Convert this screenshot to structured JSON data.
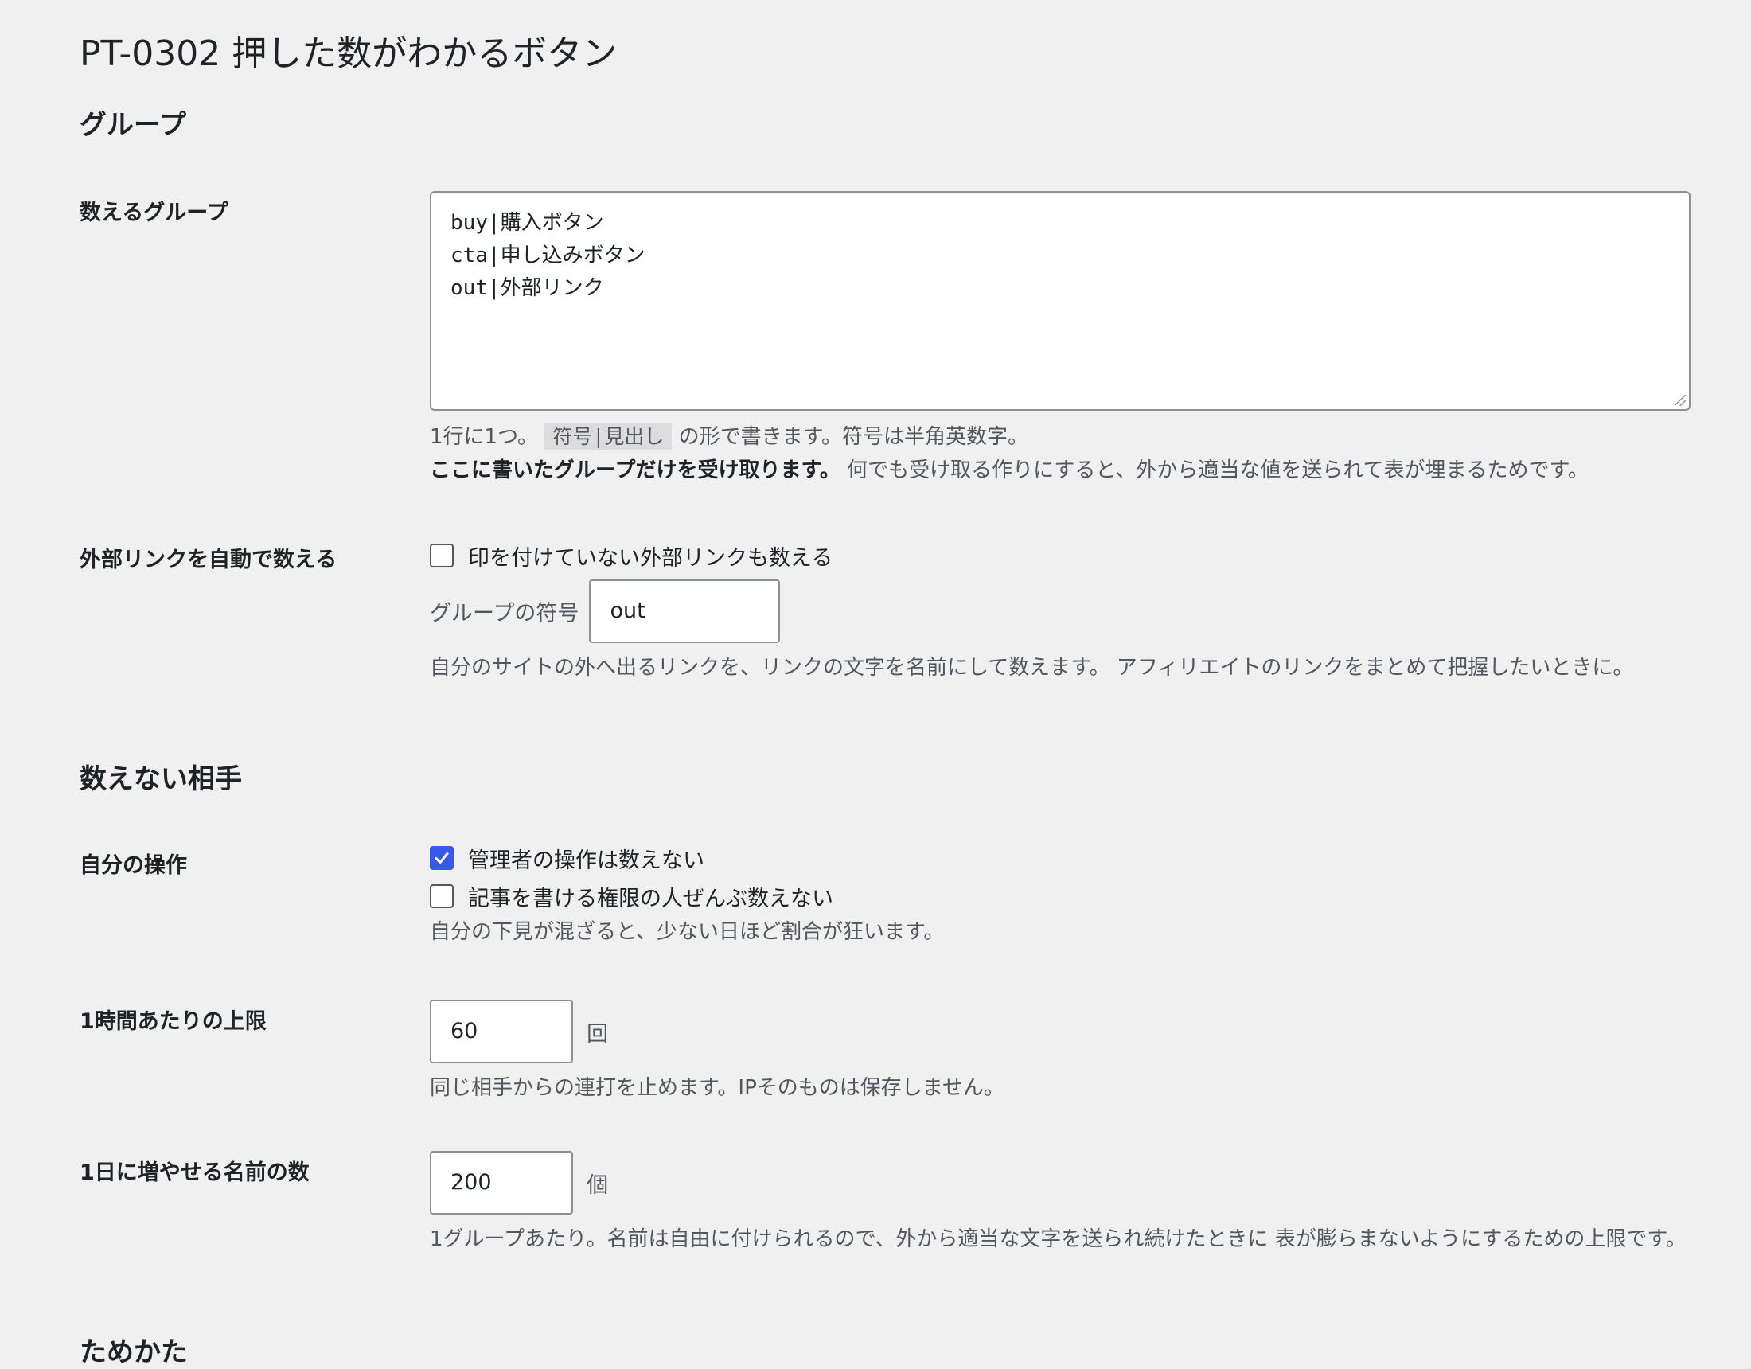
{
  "page": {
    "title": "PT-0302 押した数がわかるボタン"
  },
  "sections": {
    "group": "グループ",
    "exclude": "数えない相手",
    "storage": "ためかた"
  },
  "count_groups": {
    "label": "数えるグループ",
    "lines": [
      "buy|購入ボタン",
      "cta|申し込みボタン",
      "out|外部リンク"
    ],
    "desc_prefix": "1行に1つ。",
    "desc_code": "符号|見出し",
    "desc_suffix": "の形で書きます。符号は半角英数字。",
    "desc_bold": "ここに書いたグループだけを受け取ります。",
    "desc_rest": "何でも受け取る作りにすると、外から適当な値を送られて表が埋まるためです。"
  },
  "external_links": {
    "label": "外部リンクを自動で数える",
    "checkbox_label": "印を付けていない外部リンクも数える",
    "checked": false,
    "symbol_label": "グループの符号",
    "symbol_value": "out",
    "desc": "自分のサイトの外へ出るリンクを、リンクの文字を名前にして数えます。 アフィリエイトのリンクをまとめて把握したいときに。"
  },
  "own_actions": {
    "label": "自分の操作",
    "admin_label": "管理者の操作は数えない",
    "admin_checked": true,
    "editors_label": "記事を書ける権限の人ぜんぶ数えない",
    "editors_checked": false,
    "desc": "自分の下見が混ざると、少ない日ほど割合が狂います。"
  },
  "hourly_limit": {
    "label": "1時間あたりの上限",
    "value": "60",
    "unit": "回",
    "desc": "同じ相手からの連打を止めます。IPそのものは保存しません。"
  },
  "daily_names": {
    "label": "1日に増やせる名前の数",
    "value": "200",
    "unit": "個",
    "desc": "1グループあたり。名前は自由に付けられるので、外から適当な文字を送られ続けたときに 表が膨らまないようにするための上限です。"
  },
  "colors": {
    "background": "#f0f0f1",
    "accent": "#3858e9",
    "text": "#1d2327",
    "muted": "#50575e"
  }
}
